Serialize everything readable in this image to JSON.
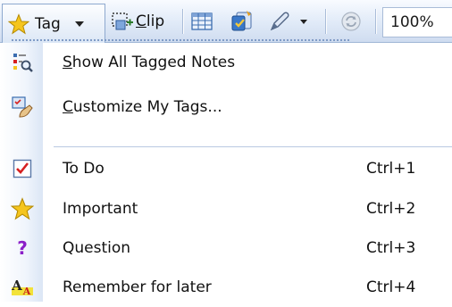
{
  "toolbar": {
    "tag_label": "Tag",
    "clip_label": "Clip",
    "zoom_value": "100%"
  },
  "menu": {
    "items": [
      {
        "label": "Show All Tagged Notes",
        "accel": "S",
        "rest": "how All Tagged Notes",
        "shortcut": "",
        "icon": "tag-search-icon"
      },
      {
        "label": "Customize My Tags...",
        "accel": "C",
        "rest": "ustomize My Tags...",
        "shortcut": "",
        "icon": "customize-tags-icon"
      },
      {
        "label": "To Do",
        "shortcut": "Ctrl+1",
        "icon": "checkbox-icon"
      },
      {
        "label": "Important",
        "shortcut": "Ctrl+2",
        "icon": "star-icon"
      },
      {
        "label": "Question",
        "shortcut": "Ctrl+3",
        "icon": "question-mark-icon"
      },
      {
        "label": "Remember for later",
        "shortcut": "Ctrl+4",
        "icon": "highlighter-text-icon"
      }
    ]
  },
  "colors": {
    "toolbar_top": "#f9fbff",
    "toolbar_bottom": "#cfdcf0",
    "star": "#f5c51e",
    "check_red": "#d62020",
    "question_purple": "#8b1fc8",
    "separator": "#b9c9e2"
  }
}
